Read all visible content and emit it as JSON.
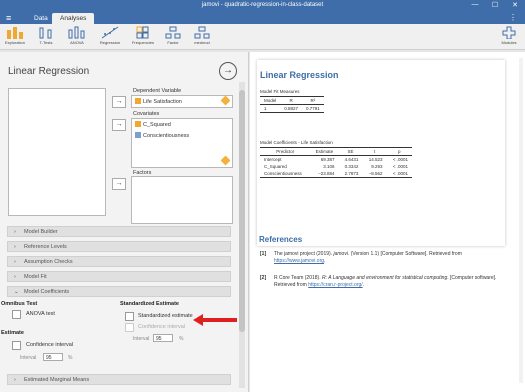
{
  "window": {
    "title": "jamovi - quadratic-regression-in-class-dataset",
    "minimize": "—",
    "maximize": "☐",
    "close": "✕"
  },
  "tabs": {
    "data": "Data",
    "analyses": "Analyses"
  },
  "ribbon": {
    "exploration": "Exploration",
    "ttests": "T-Tests",
    "anova": "ANOVA",
    "regression": "Regression",
    "frequencies": "Frequencies",
    "factor": "Factor",
    "medmod": "medmod",
    "modules": "Modules"
  },
  "analysis": {
    "title": "Linear Regression",
    "dependent_label": "Dependent Variable",
    "dependent_var": "Life Satisfaction",
    "covariates_label": "Covariates",
    "covariates": [
      "C_Squared",
      "Conscientiousness"
    ],
    "factors_label": "Factors",
    "sections": [
      "Model Builder",
      "Reference Levels",
      "Assumption Checks",
      "Model Fit",
      "Model Coefficients",
      "Estimated Marginal Means"
    ],
    "omnibus_test": "Omnibus Test",
    "anova_test": "ANOVA test",
    "estimate": "Estimate",
    "confidence_interval": "Confidence interval",
    "interval_label": "Interval",
    "interval_value": "95",
    "percent": "%",
    "standardized_estimate_header": "Standardized Estimate",
    "standardized_estimate": "Standardized estimate",
    "std_confidence_interval": "Confidence interval",
    "std_interval_label": "Interval",
    "std_interval_value": "95",
    "std_percent": "%"
  },
  "results": {
    "title": "Linear Regression",
    "fit_caption": "Model Fit Measures",
    "fit_headers": [
      "Model",
      "R",
      "R²"
    ],
    "fit_row": [
      "1",
      "0.8827",
      "0.7791"
    ],
    "coef_caption": "Model Coefficients - Life Satisfaction",
    "coef_headers": [
      "Predictor",
      "Estimate",
      "SE",
      "t",
      "p"
    ],
    "coef_rows": [
      [
        "Intercept",
        "69.387",
        "4.6431",
        "14.523",
        "< .0001"
      ],
      [
        "C_Squared",
        "3.106",
        "0.3342",
        "9.293",
        "< .0001"
      ],
      [
        "Conscientiousness",
        "−23.884",
        "2.7873",
        "−8.562",
        "< .0001"
      ]
    ],
    "references_title": "References",
    "ref1_num": "[1]",
    "ref1_text": "The jamovi project (2019). ",
    "ref1_italic": "jamovi",
    "ref1_rest": ". (Version 1.1) [Computer Software]. Retrieved from",
    "ref1_link": "https://www.jamovi.org",
    "ref1_end": ".",
    "ref2_num": "[2]",
    "ref2_text": "R Core Team (2018). ",
    "ref2_italic": "R: A Language and environment for statistical computing",
    "ref2_rest": ". [Computer software]. Retrieved from ",
    "ref2_link": "https://cran.r-project.org/",
    "ref2_end": "."
  },
  "colors": {
    "brand": "#3e6da9",
    "pencil": "#f3b03c",
    "arrow": "#e02020"
  },
  "icons": [
    "hamburger-icon",
    "kebab-icon",
    "go-arrow-icon",
    "arrow-right-icon",
    "pencil-icon",
    "ruler-icon",
    "chevron-right-icon",
    "chevron-down-icon",
    "plus-icon"
  ]
}
